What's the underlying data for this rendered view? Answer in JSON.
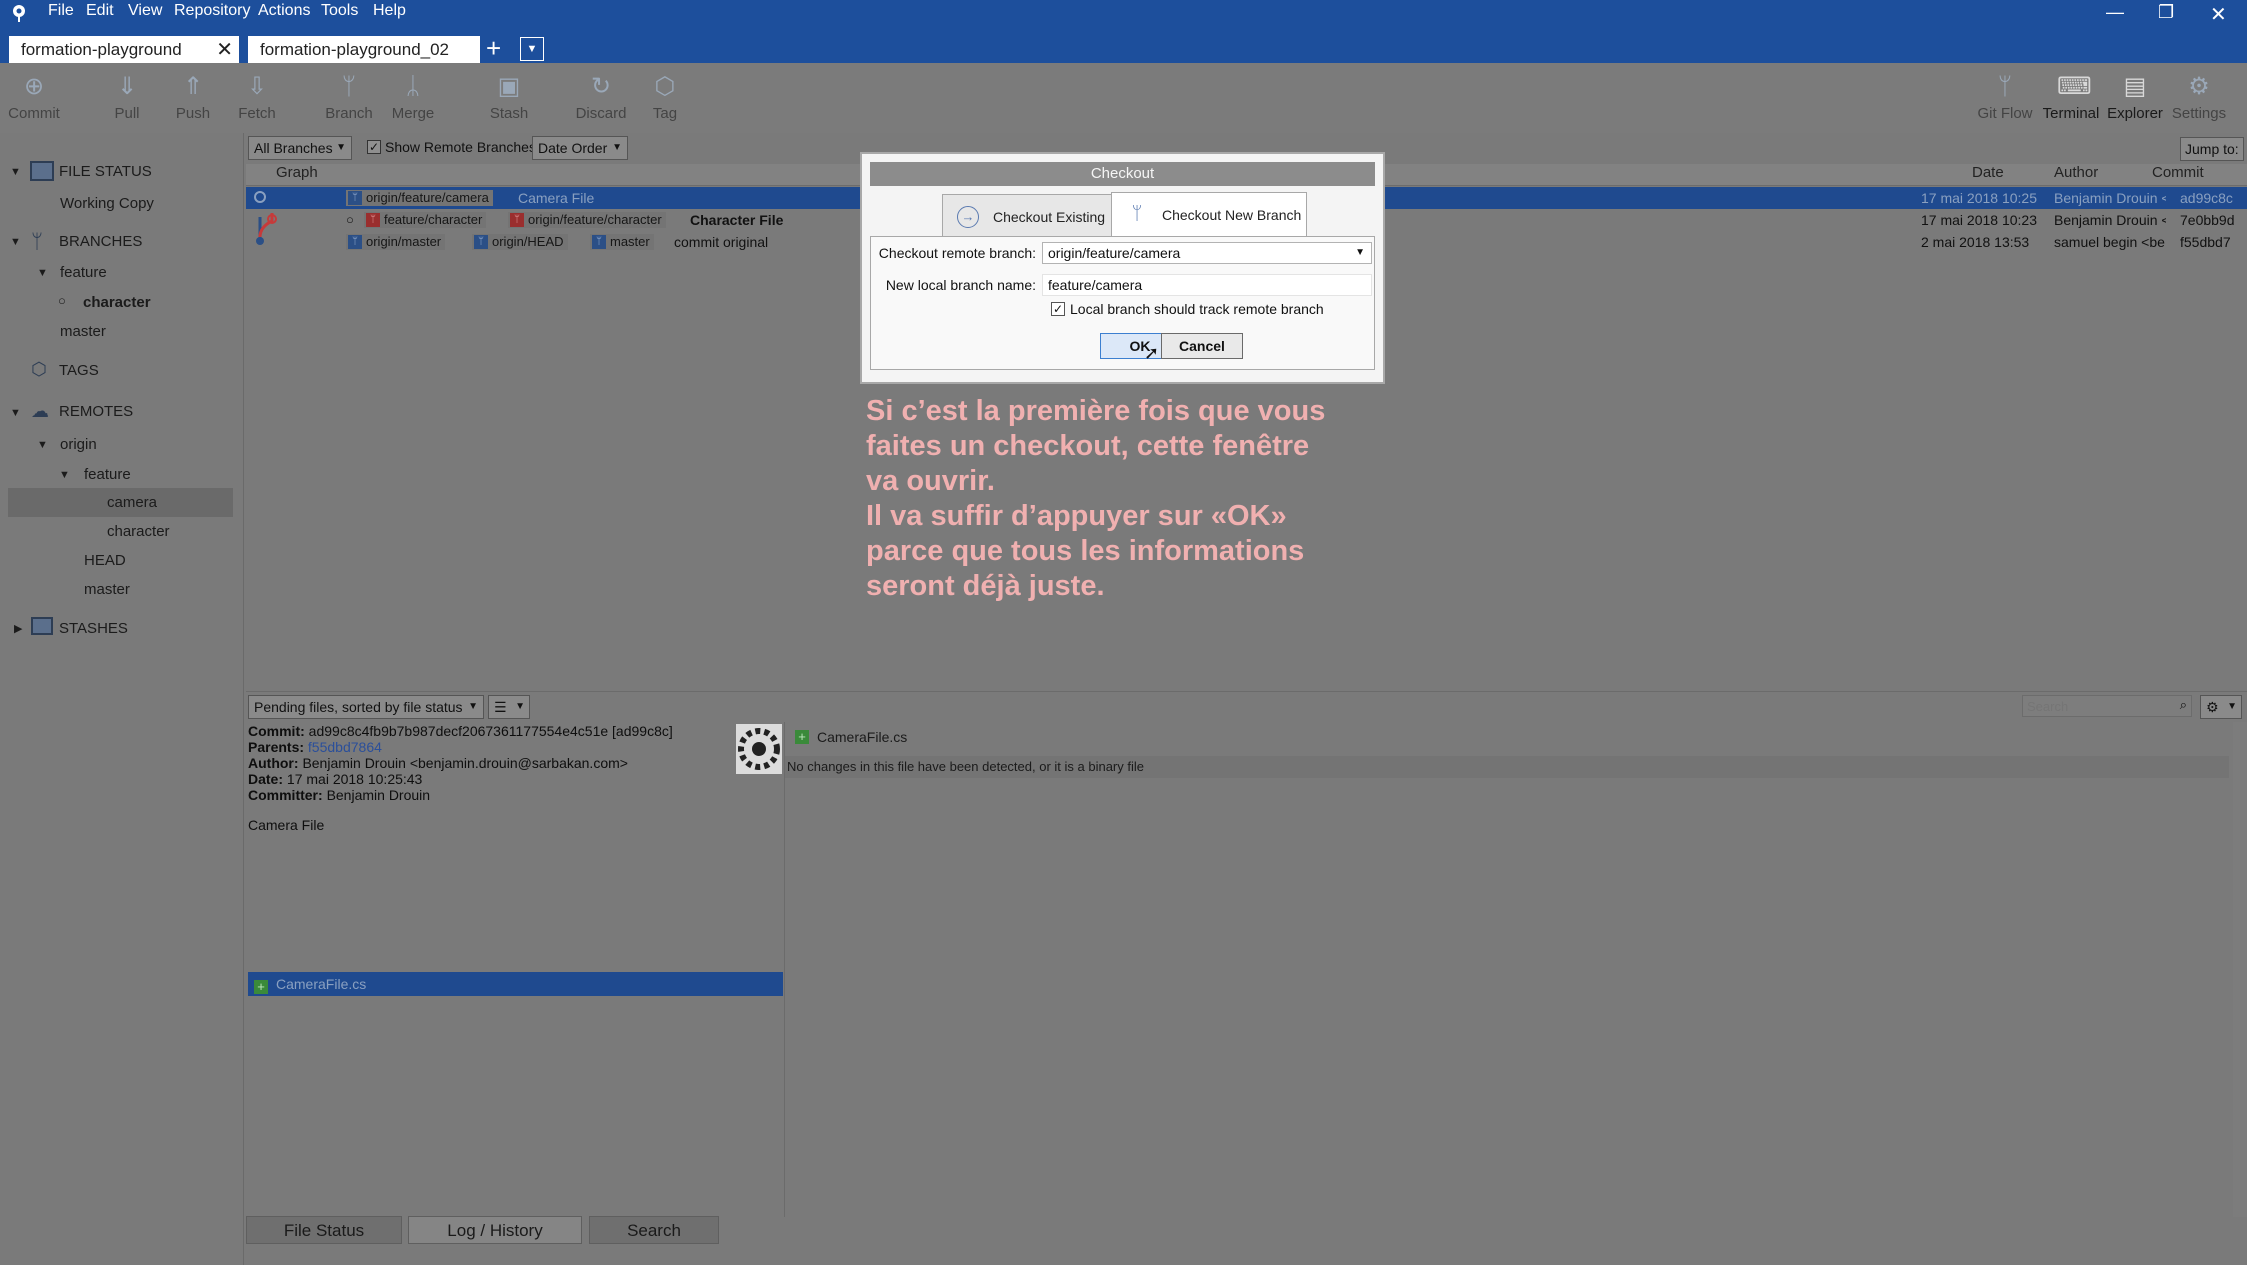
{
  "menu": [
    "File",
    "Edit",
    "View",
    "Repository",
    "Actions",
    "Tools",
    "Help"
  ],
  "tabs": [
    {
      "label": "formation-playground",
      "close": "✕"
    },
    {
      "label": "formation-playground_02"
    }
  ],
  "toolbar": {
    "commit": "Commit",
    "pull": "Pull",
    "push": "Push",
    "fetch": "Fetch",
    "branch": "Branch",
    "merge": "Merge",
    "stash": "Stash",
    "discard": "Discard",
    "tag": "Tag",
    "gitflow": "Git Flow",
    "terminal": "Terminal",
    "explorer": "Explorer",
    "settings": "Settings"
  },
  "sidebar": {
    "file_status": "FILE STATUS",
    "working_copy": "Working Copy",
    "branches": "BRANCHES",
    "feature": "feature",
    "character": "character",
    "master": "master",
    "tags": "TAGS",
    "remotes": "REMOTES",
    "origin": "origin",
    "r_feature": "feature",
    "r_camera": "camera",
    "r_character": "character",
    "head": "HEAD",
    "r_master": "master",
    "stashes": "STASHES"
  },
  "filter": {
    "branches": "All Branches",
    "show_remote": "Show Remote Branches",
    "order": "Date Order",
    "jump": "Jump to:"
  },
  "grid": {
    "headers": {
      "graph": "Graph",
      "date": "Date",
      "author": "Author",
      "commit": "Commit"
    },
    "rows": [
      {
        "tags": [
          "origin/feature/camera"
        ],
        "message": "Camera File",
        "date": "17 mai 2018 10:25",
        "author": "Benjamin Drouin <",
        "commit": "ad99c8c"
      },
      {
        "tags": [
          "feature/character",
          "origin/feature/character"
        ],
        "message": "Character File",
        "date": "17 mai 2018 10:23",
        "author": "Benjamin Drouin <",
        "commit": "7e0bb9d"
      },
      {
        "tags": [
          "origin/master",
          "origin/HEAD",
          "master"
        ],
        "message": "commit original",
        "date": "2 mai 2018 13:53",
        "author": "samuel begin <be",
        "commit": "f55dbd7"
      }
    ]
  },
  "dialog": {
    "title": "Checkout",
    "tab_existing": "Checkout Existing",
    "tab_new": "Checkout New Branch",
    "remote_label": "Checkout remote branch:",
    "remote_value": "origin/feature/camera",
    "local_label": "New local branch name:",
    "local_value": "feature/camera",
    "track_label": "Local branch should track remote branch",
    "ok": "OK",
    "cancel": "Cancel"
  },
  "annotation": "Si c’est la première fois que vous\nfaites un checkout, cette fenêtre\nva ouvrir.\nIl va suffir d’appuyer sur «OK»\nparce que tous les informations\nseront déjà juste.",
  "bottom": {
    "pending": "Pending files, sorted by file status",
    "search_placeholder": "Search"
  },
  "commit_info": {
    "commit_label": "Commit:",
    "commit_value": "ad99c8c4fb9b7b987decf2067361177554e4c51e [ad99c8c]",
    "parents_label": "Parents:",
    "parents_value": "f55dbd7864",
    "author_label": "Author:",
    "author_value": "Benjamin Drouin <benjamin.drouin@sarbakan.com>",
    "date_label": "Date:",
    "date_value": "17 mai 2018 10:25:43",
    "committer_label": "Committer:",
    "committer_value": "Benjamin Drouin",
    "message": "Camera File"
  },
  "files": {
    "selected": "CameraFile.cs"
  },
  "diff": {
    "file": "CameraFile.cs",
    "note": "No changes in this file have been detected, or it is a binary file"
  },
  "bottom_tabs": [
    "File Status",
    "Log / History",
    "Search"
  ]
}
